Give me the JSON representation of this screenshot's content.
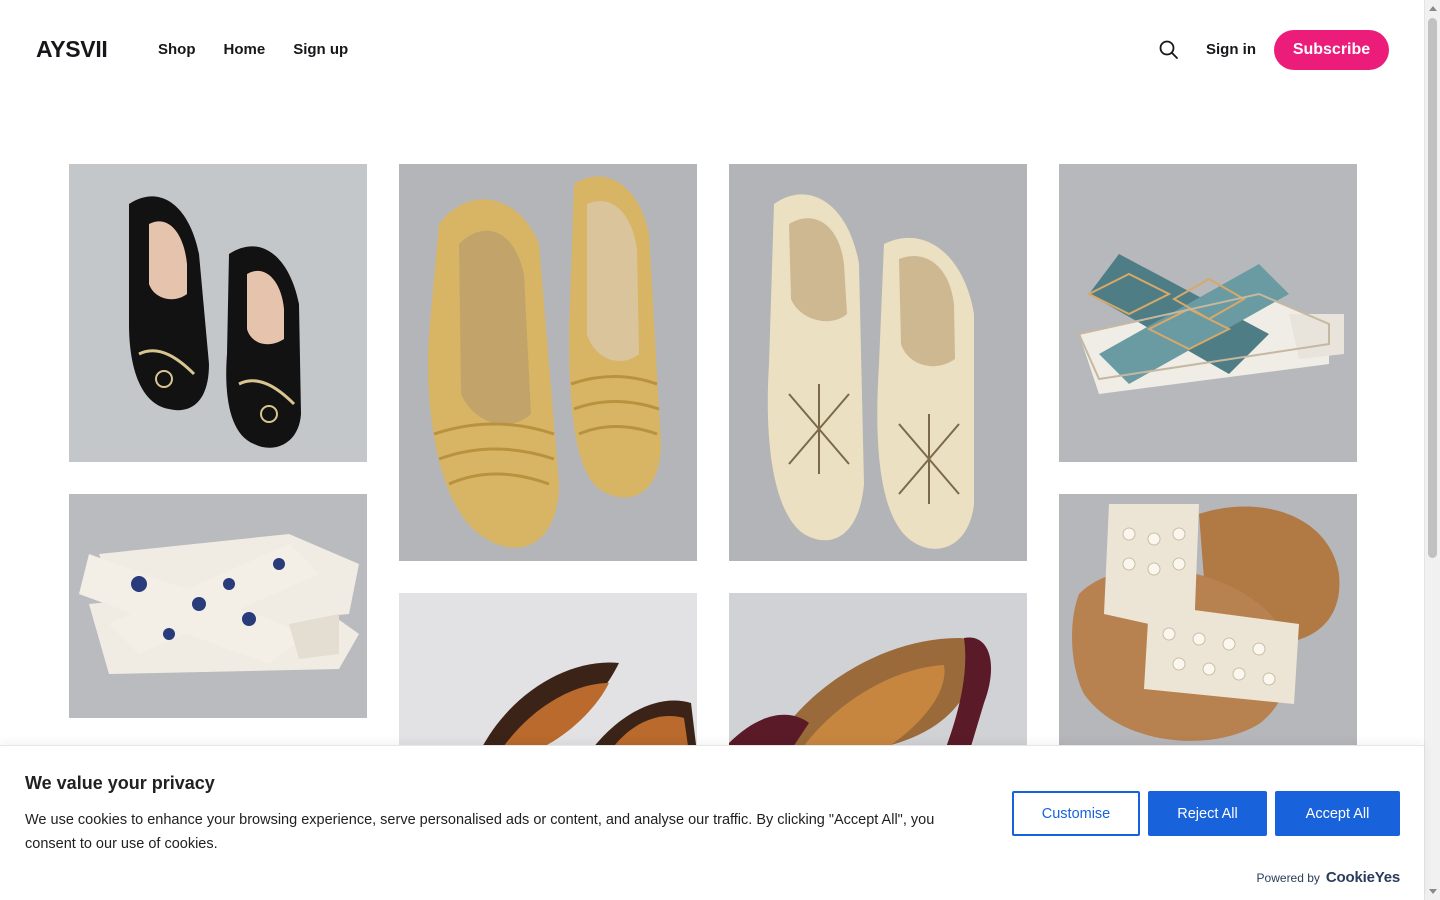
{
  "header": {
    "logo": "AYSVII",
    "nav": [
      "Shop",
      "Home",
      "Sign up"
    ],
    "signin": "Sign in",
    "subscribe": "Subscribe",
    "accent_color": "#ec1c7a"
  },
  "gallery": {
    "items": [
      {
        "name": "black embroidered ankle-strap mules",
        "icon": "shoe-photo"
      },
      {
        "name": "gold sequin flat juttis",
        "icon": "shoe-photo"
      },
      {
        "name": "cream beaded ankle-strap heels",
        "icon": "shoe-photo"
      },
      {
        "name": "teal beaded cross-strap block heels",
        "icon": "shoe-photo"
      },
      {
        "name": "navy print cross-strap block heels",
        "icon": "shoe-photo"
      },
      {
        "name": "brown leather juttis",
        "icon": "shoe-photo"
      },
      {
        "name": "maroon embroidered tan juttis",
        "icon": "shoe-photo"
      },
      {
        "name": "pearl embellished tan flat sliders",
        "icon": "shoe-photo"
      }
    ]
  },
  "cookie": {
    "title": "We value your privacy",
    "text": "We use cookies to enhance your browsing experience, serve personalised ads or content, and analyse our traffic. By clicking \"Accept All\", you consent to our use of cookies.",
    "customise": "Customise",
    "reject": "Reject All",
    "accept": "Accept All",
    "powered_label": "Powered by",
    "powered_brand": "CookieYes",
    "button_color": "#1863dc"
  }
}
